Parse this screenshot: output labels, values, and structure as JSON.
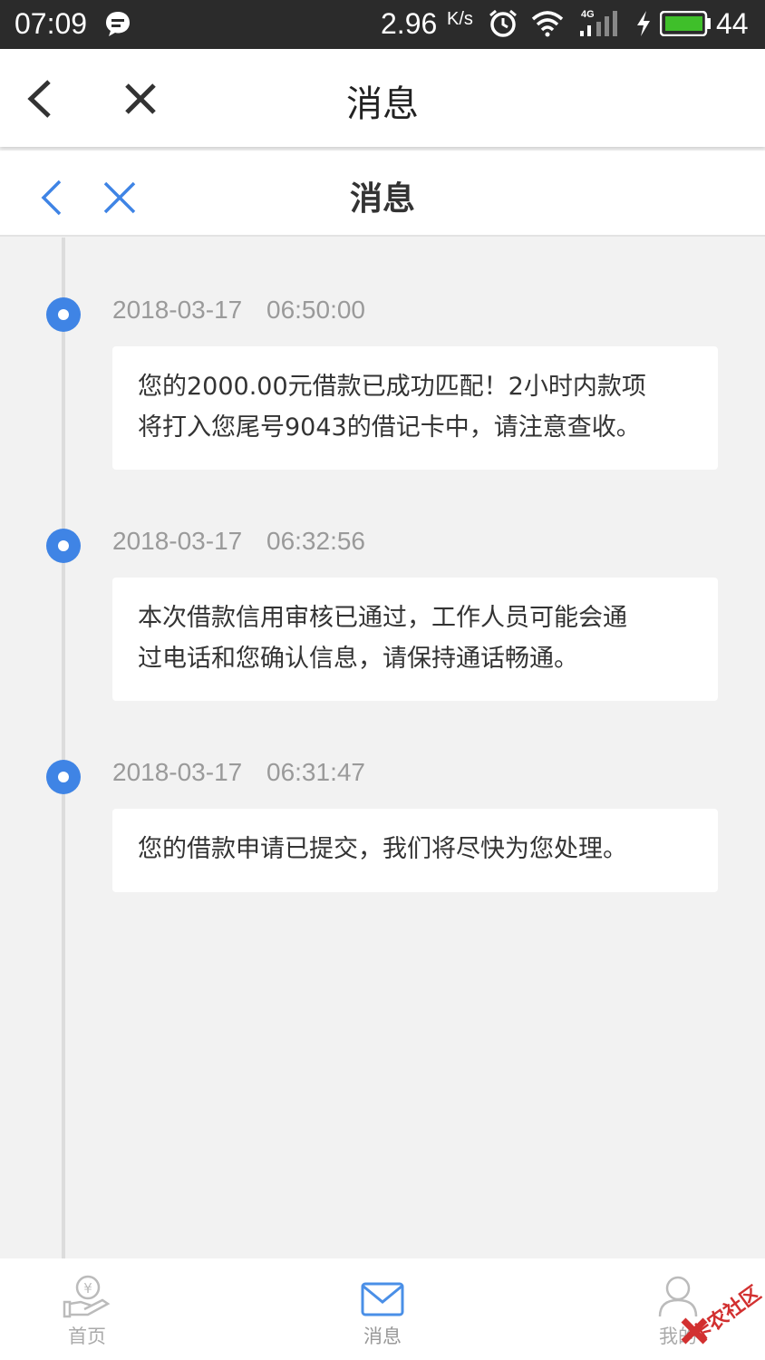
{
  "status_bar": {
    "time": "07:09",
    "speed": "2.96",
    "speed_unit": "K/s",
    "network": "4G",
    "battery": "44"
  },
  "outer_bar": {
    "title": "消息"
  },
  "inner_bar": {
    "title": "消息"
  },
  "messages": [
    {
      "date": "2018-03-17",
      "time": "06:50:00",
      "lines": [
        "您的2000.00元借款已成功匹配！2小时内款项",
        "将打入您尾号9043的借记卡中，请注意查收。"
      ]
    },
    {
      "date": "2018-03-17",
      "time": "06:32:56",
      "lines": [
        "本次借款信用审核已通过，工作人员可能会通",
        "过电话和您确认信息，请保持通话畅通。"
      ]
    },
    {
      "date": "2018-03-17",
      "time": "06:31:47",
      "lines": [
        "您的借款申请已提交，我们将尽快为您处理。"
      ]
    }
  ],
  "tabs": [
    {
      "label": "首页",
      "icon": "home-hand-coin-icon"
    },
    {
      "label": "消息",
      "icon": "envelope-icon"
    },
    {
      "label": "我的",
      "icon": "user-icon"
    }
  ],
  "watermark": "卡农社区",
  "colors": {
    "accent": "#3f84e5",
    "status_bar_bg": "#2b2b2b",
    "background": "#f2f2f2"
  }
}
